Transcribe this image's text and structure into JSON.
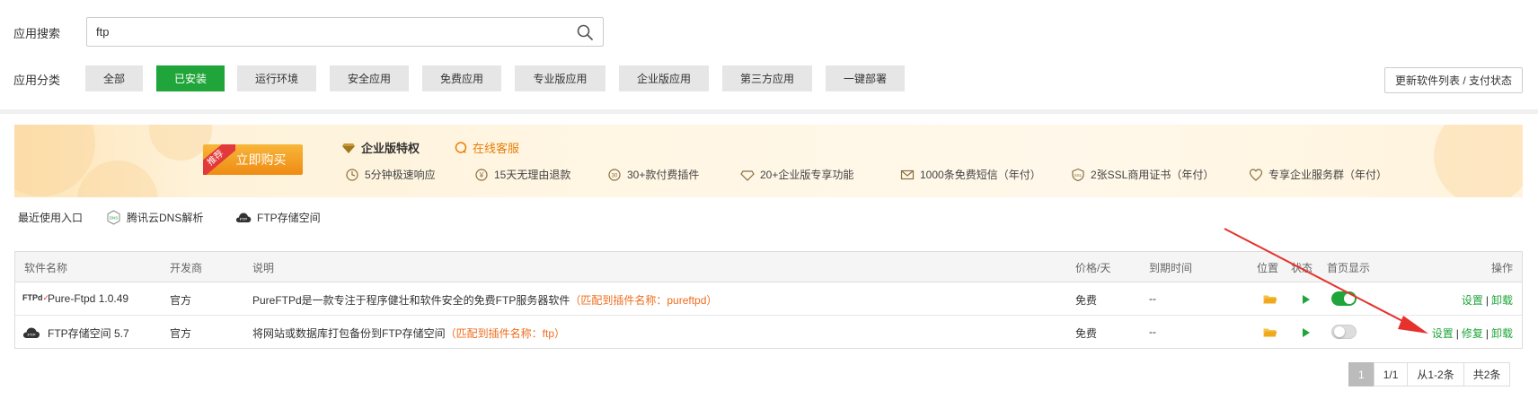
{
  "search": {
    "label": "应用搜索",
    "value": "ftp"
  },
  "categories": {
    "label": "应用分类",
    "items": [
      {
        "label": "全部",
        "active": false
      },
      {
        "label": "已安装",
        "active": true
      },
      {
        "label": "运行环境",
        "active": false
      },
      {
        "label": "安全应用",
        "active": false
      },
      {
        "label": "免费应用",
        "active": false
      },
      {
        "label": "专业版应用",
        "active": false
      },
      {
        "label": "企业版应用",
        "active": false
      },
      {
        "label": "第三方应用",
        "active": false
      },
      {
        "label": "一键部署",
        "active": false
      }
    ]
  },
  "refresh_button": "更新软件列表 / 支付状态",
  "banner": {
    "tag": "推荐",
    "buy": "立即购买",
    "title": "企业版特权",
    "service": "在线客服",
    "features": [
      "5分钟极速响应",
      "15天无理由退款",
      "30+款付费插件",
      "20+企业版专享功能",
      "1000条免费短信（年付）",
      "2张SSL商用证书（年付）",
      "专享企业服务群（年付）"
    ]
  },
  "recent": {
    "label": "最近使用入口",
    "items": [
      "腾讯云DNS解析",
      "FTP存储空间"
    ]
  },
  "table": {
    "headers": {
      "name": "软件名称",
      "developer": "开发商",
      "desc": "说明",
      "price": "价格/天",
      "expire": "到期时间",
      "location": "位置",
      "status": "状态",
      "homepage": "首页显示",
      "ops": "操作"
    },
    "rows": [
      {
        "icon_text": "FTPd",
        "name": "Pure-Ftpd 1.0.49",
        "developer": "官方",
        "desc": "PureFTPd是一款专注于程序健壮和软件安全的免费FTP服务器软件",
        "note": "（匹配到插件名称：pureftpd）",
        "price": "免费",
        "expire": "--",
        "homepage_on": true,
        "ops": [
          "设置",
          "卸载"
        ]
      },
      {
        "icon_text": "FTP",
        "name": "FTP存储空间 5.7",
        "developer": "官方",
        "desc": "将网站或数据库打包备份到FTP存储空间",
        "note": "（匹配到插件名称：ftp）",
        "price": "免费",
        "expire": "--",
        "homepage_on": false,
        "ops": [
          "设置",
          "修复",
          "卸载"
        ]
      }
    ]
  },
  "pagination": {
    "current": "1",
    "pages": "1/1",
    "range": "从1-2条",
    "total": "共2条"
  },
  "colors": {
    "primary": "#20a53a",
    "note": "#ef6c1d",
    "arrow": "#e5322d"
  }
}
